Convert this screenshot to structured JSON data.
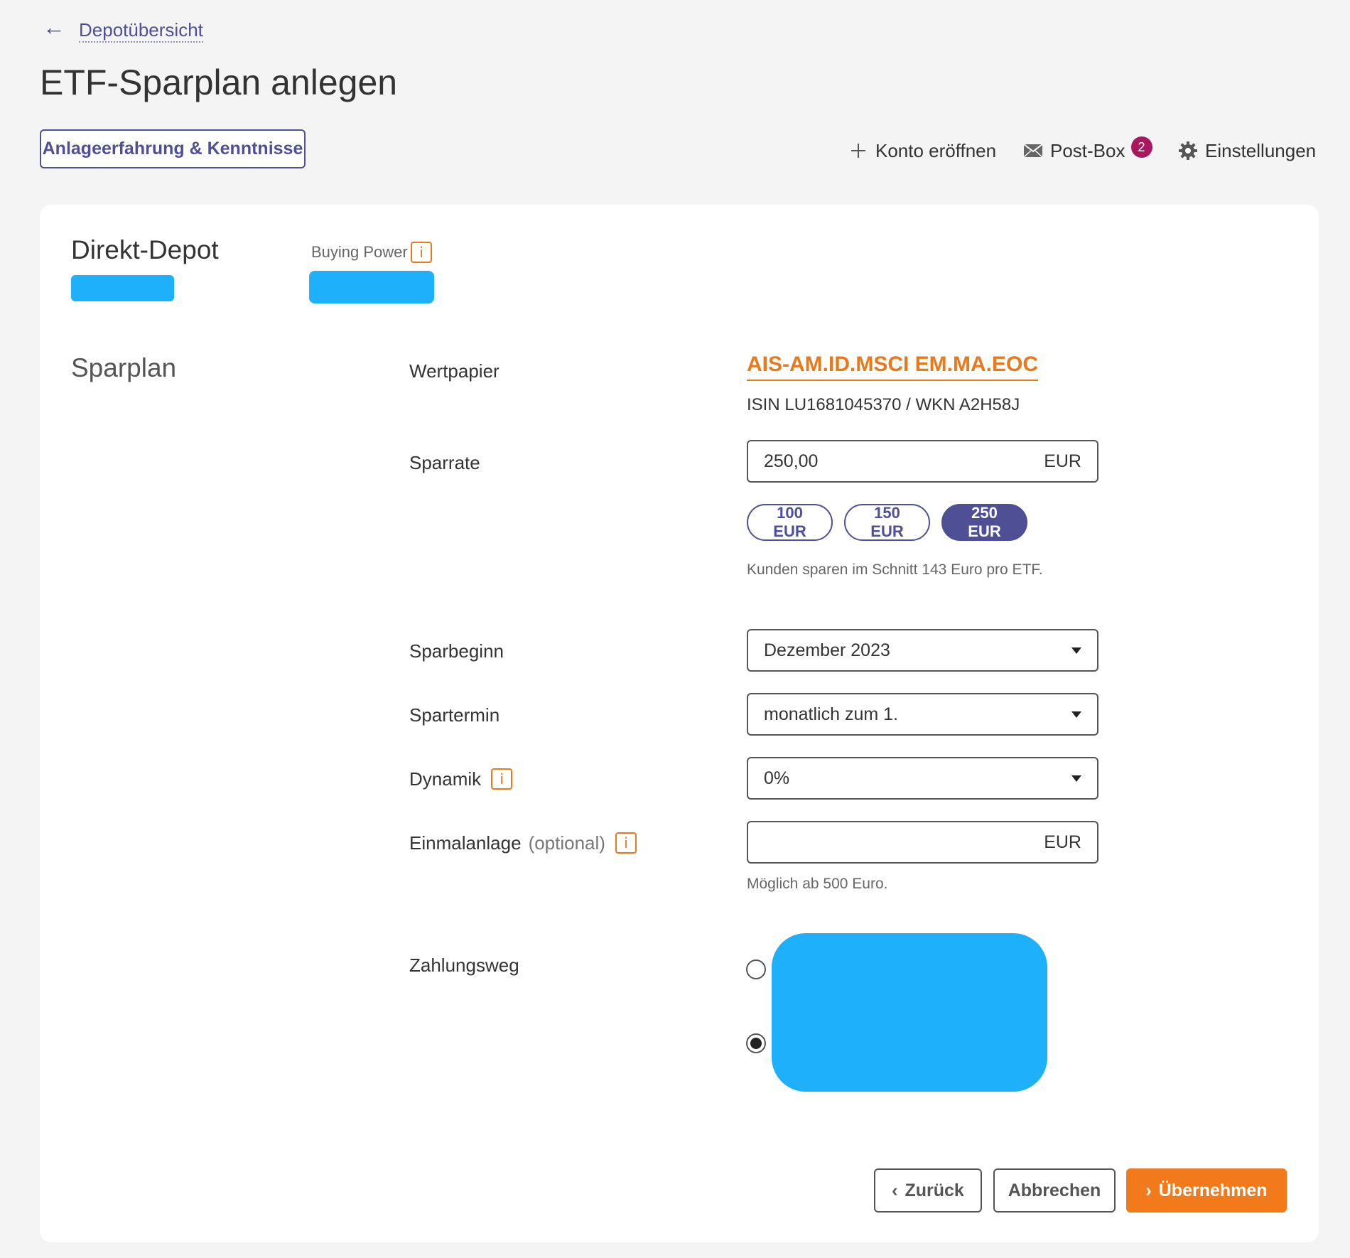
{
  "header": {
    "back_icon": "arrow-left-icon",
    "back_link": "Depotübersicht",
    "title": "ETF-Sparplan anlegen",
    "experience_button": "Anlageerfahrung & Kenntnisse"
  },
  "topnav": {
    "konto": {
      "icon": "plus-icon",
      "label": "Konto eröffnen"
    },
    "postbox": {
      "icon": "mail-icon",
      "label": "Post-Box",
      "badge": "2"
    },
    "settings": {
      "icon": "gear-icon",
      "label": "Einstellungen"
    }
  },
  "depot": {
    "title": "Direkt-Depot",
    "buying_power_label": "Buying Power",
    "info_symbol": "i"
  },
  "sparplan": {
    "section_title": "Sparplan",
    "wertpapier": {
      "label": "Wertpapier",
      "name": "AIS-AM.ID.MSCI EM.MA.EOC",
      "isin_line": "ISIN LU1681045370 / WKN A2H58J"
    },
    "sparrate": {
      "label": "Sparrate",
      "value": "250,00",
      "currency": "EUR",
      "chips": [
        "100 EUR",
        "150 EUR",
        "250 EUR"
      ],
      "selected_chip": "250 EUR",
      "hint": "Kunden sparen im Schnitt 143 Euro pro ETF."
    },
    "sparbeginn": {
      "label": "Sparbeginn",
      "value": "Dezember 2023"
    },
    "spartermin": {
      "label": "Spartermin",
      "value": "monatlich zum 1."
    },
    "dynamik": {
      "label": "Dynamik",
      "value": "0%"
    },
    "einmalanlage": {
      "label": "Einmalanlage",
      "optional": "(optional)",
      "value": "",
      "currency": "EUR",
      "hint": "Möglich ab 500 Euro."
    },
    "zahlungsweg": {
      "label": "Zahlungsweg",
      "selected_option": 2
    }
  },
  "actions": {
    "back": "Zurück",
    "cancel": "Abbrechen",
    "submit": "Übernehmen"
  },
  "colors": {
    "primary": "#4f4f96",
    "accent": "#f27a1a",
    "redacted": "#1eb0fb",
    "badge": "#a8185e"
  }
}
